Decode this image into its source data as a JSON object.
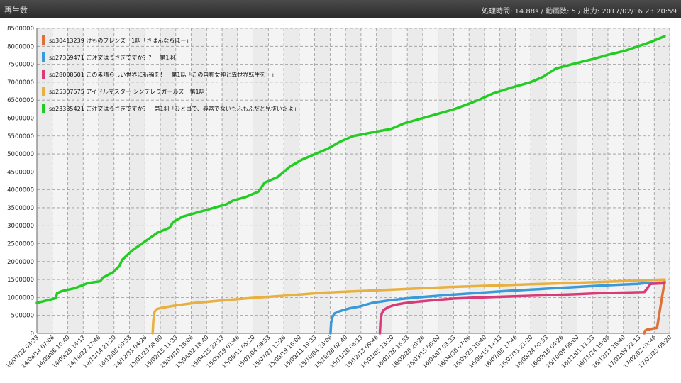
{
  "window": {
    "title": "再生数",
    "status": "処理時間: 14.88s / 動画数: 5 / 出力: 2017/02/16 23:20:59"
  },
  "chart_data": {
    "type": "line",
    "title": "",
    "xlabel": "",
    "ylabel": "",
    "ylim": [
      0,
      8500000
    ],
    "y_ticks": [
      "0",
      "500000",
      "1000000",
      "1500000",
      "2000000",
      "2500000",
      "3000000",
      "3500000",
      "4000000",
      "4500000",
      "5000000",
      "5500000",
      "6000000",
      "6500000",
      "7000000",
      "7500000",
      "8000000",
      "8500000"
    ],
    "x_ticks": [
      "14/07/22 03:33",
      "14/08/14 07:06",
      "14/09/06 10:40",
      "14/09/29 14:13",
      "14/10/22 17:46",
      "14/11/14 21:20",
      "14/12/08 00:53",
      "14/12/31 04:26",
      "15/01/23 08:00",
      "15/02/15 11:33",
      "15/03/10 15:06",
      "15/04/02 18:40",
      "15/04/25 22:13",
      "15/05/19 01:46",
      "15/06/11 05:20",
      "15/07/04 08:53",
      "15/07/27 12:26",
      "15/08/19 16:00",
      "15/09/11 19:33",
      "15/10/04 23:06",
      "15/10/28 02:40",
      "15/11/20 06:13",
      "15/12/13 09:46",
      "16/01/05 13:20",
      "16/01/28 16:53",
      "16/02/20 20:26",
      "16/03/15 00:00",
      "16/04/07 03:33",
      "16/04/30 07:06",
      "16/05/23 10:40",
      "16/06/15 14:13",
      "16/07/08 17:46",
      "16/07/31 21:20",
      "16/08/24 00:53",
      "16/09/16 04:26",
      "16/10/09 08:00",
      "16/11/01 11:33",
      "16/11/24 15:06",
      "16/12/17 18:40",
      "17/01/09 22:13",
      "17/02/02 01:46",
      "17/02/25 05:20"
    ],
    "grid": true,
    "legend_position": "top-left",
    "series": [
      {
        "name": "so30413239 けものフレンズ　1話「さばんなちほー」",
        "color": "#e0703a",
        "x": [
          0.96,
          0.961,
          0.964,
          0.97,
          0.976,
          0.98,
          0.9805,
          0.986,
          0.992
        ],
        "y": [
          0,
          70000,
          100000,
          120000,
          140000,
          150000,
          200000,
          800000,
          1450000
        ]
      },
      {
        "name": "so27369471 ご注文はうさぎですか？？　第1羽",
        "color": "#3a9ad9",
        "x": [
          0.464,
          0.465,
          0.467,
          0.47,
          0.476,
          0.485,
          0.495,
          0.51,
          0.53,
          0.56,
          0.6,
          0.65,
          0.7,
          0.75,
          0.8,
          0.85,
          0.9,
          0.95,
          0.96,
          0.992
        ],
        "y": [
          0,
          300000,
          450000,
          550000,
          600000,
          650000,
          700000,
          750000,
          850000,
          930000,
          1000000,
          1070000,
          1130000,
          1190000,
          1240000,
          1290000,
          1340000,
          1380000,
          1400000,
          1420000
        ]
      },
      {
        "name": "so28008501 この素晴らしい世界に祝福を！　第1話「この自称女神と異世界転生を！」",
        "color": "#d93a7a",
        "x": [
          0.542,
          0.543,
          0.545,
          0.548,
          0.555,
          0.565,
          0.58,
          0.6,
          0.63,
          0.66,
          0.7,
          0.75,
          0.8,
          0.85,
          0.89,
          0.91,
          0.96,
          0.97,
          0.992
        ],
        "y": [
          0,
          350000,
          550000,
          650000,
          730000,
          790000,
          840000,
          880000,
          930000,
          970000,
          1000000,
          1030000,
          1060000,
          1090000,
          1120000,
          1130000,
          1150000,
          1380000,
          1400000
        ]
      },
      {
        "name": "so25307575 アイドルマスター シンデレラガールズ　第1話",
        "color": "#e8b040",
        "x": [
          0.183,
          0.184,
          0.186,
          0.19,
          0.2,
          0.22,
          0.25,
          0.3,
          0.35,
          0.4,
          0.45,
          0.5,
          0.55,
          0.6,
          0.65,
          0.7,
          0.75,
          0.8,
          0.85,
          0.9,
          0.95,
          0.992
        ],
        "y": [
          0,
          350000,
          600000,
          680000,
          720000,
          780000,
          850000,
          930000,
          1000000,
          1060000,
          1130000,
          1170000,
          1210000,
          1250000,
          1290000,
          1320000,
          1350000,
          1380000,
          1410000,
          1440000,
          1470000,
          1500000
        ]
      },
      {
        "name": "so23335421 ご注文はうさぎですか？　第1羽「ひと目で、尋常でないもふもふだと見抜いたよ」",
        "color": "#22cc22",
        "x": [
          0.0,
          0.03,
          0.032,
          0.04,
          0.06,
          0.075,
          0.08,
          0.1,
          0.105,
          0.12,
          0.13,
          0.135,
          0.15,
          0.17,
          0.19,
          0.21,
          0.215,
          0.23,
          0.26,
          0.28,
          0.3,
          0.31,
          0.33,
          0.35,
          0.36,
          0.38,
          0.4,
          0.42,
          0.44,
          0.46,
          0.48,
          0.5,
          0.53,
          0.56,
          0.58,
          0.6,
          0.63,
          0.66,
          0.68,
          0.7,
          0.72,
          0.75,
          0.78,
          0.8,
          0.82,
          0.85,
          0.88,
          0.9,
          0.93,
          0.95,
          0.97,
          0.992
        ],
        "y": [
          850000,
          980000,
          1120000,
          1180000,
          1260000,
          1360000,
          1400000,
          1450000,
          1560000,
          1700000,
          1870000,
          2050000,
          2300000,
          2550000,
          2800000,
          2950000,
          3100000,
          3250000,
          3400000,
          3500000,
          3600000,
          3700000,
          3800000,
          3950000,
          4200000,
          4350000,
          4650000,
          4850000,
          5000000,
          5150000,
          5350000,
          5500000,
          5600000,
          5700000,
          5850000,
          5950000,
          6100000,
          6250000,
          6380000,
          6520000,
          6680000,
          6850000,
          7000000,
          7150000,
          7380000,
          7520000,
          7650000,
          7750000,
          7880000,
          8000000,
          8120000,
          8280000
        ]
      }
    ]
  }
}
